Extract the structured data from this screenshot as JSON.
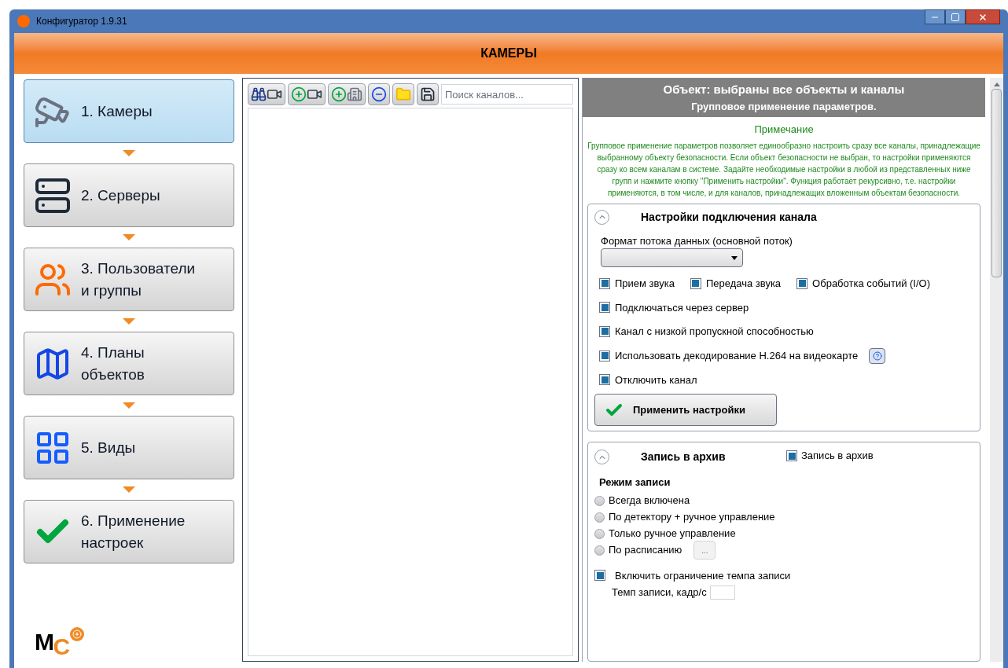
{
  "window": {
    "title": "Конфигуратор 1.9.31"
  },
  "header": {
    "title": "КАМЕРЫ"
  },
  "sidebar": {
    "items": [
      {
        "kind": "camera",
        "lines": [
          "1. Камеры"
        ],
        "selected": true
      },
      {
        "kind": "server",
        "lines": [
          "2. Серверы"
        ],
        "selected": false
      },
      {
        "kind": "users",
        "lines": [
          "3. Пользователи",
          "и группы"
        ],
        "selected": false
      },
      {
        "kind": "plans",
        "lines": [
          "4. Планы",
          "объектов"
        ],
        "selected": false
      },
      {
        "kind": "views",
        "lines": [
          "5. Виды"
        ],
        "selected": false
      },
      {
        "kind": "apply",
        "lines": [
          "6. Применение",
          "настроек"
        ],
        "selected": false
      }
    ]
  },
  "logo": {
    "letters": [
      "M",
      "C"
    ]
  },
  "toolbar": {
    "buttons": [
      {
        "kind": "find"
      },
      {
        "kind": "add-camera"
      },
      {
        "kind": "add-object"
      },
      {
        "kind": "remove"
      },
      {
        "kind": "open"
      },
      {
        "kind": "save"
      }
    ],
    "search": {
      "placeholder": "Поиск каналов..."
    }
  },
  "object_header": {
    "title": "Объект:  выбраны все объекты и каналы",
    "subtitle": "Групповое применение параметров."
  },
  "note": {
    "title": "Примечание",
    "text": "Групповое применение параметров позволяет единообразно настроить сразу все каналы, принадлежащие выбранному объекту безопасности. Если объект безопасности не выбран, то настройки применяются сразу ко всем каналам в системе. Задайте необходимые настройки в любой из представленных ниже групп и нажмите кнопку \"Применить настройки\".  Функция работает рекурсивно, т.е. настройки применяются, в том числе, и для каналов, принадлежащих вложенным объектам безопасности."
  },
  "connection": {
    "title": "Настройки подключения канала",
    "expanded": true,
    "format_label": "Формат потока данных (основной поток)",
    "checkbox_rows": [
      [
        {
          "label": "Прием звука",
          "indeterminate": true
        },
        {
          "label": "Передача звука",
          "indeterminate": true
        },
        {
          "label": "Обработка событий (I/O)",
          "indeterminate": true
        }
      ],
      [
        {
          "label": "Подключаться через сервер",
          "indeterminate": true
        }
      ],
      [
        {
          "label": "Канал с низкой пропускной способностью",
          "indeterminate": true
        }
      ],
      [
        {
          "label": "Использовать декодирование H.264 на видеокарте",
          "indeterminate": true,
          "help": true
        }
      ],
      [
        {
          "label": "Отключить канал",
          "indeterminate": true
        }
      ]
    ],
    "apply_button": "Применить настройки"
  },
  "archive": {
    "title": "Запись в архив",
    "expanded": true,
    "checkbox": {
      "label": "Запись в архив",
      "indeterminate": true
    },
    "mode_label": "Режим записи",
    "modes": [
      {
        "label": "Всегда включена",
        "selected": false
      },
      {
        "label": "По детектору + ручное управление",
        "selected": false
      },
      {
        "label": "Только ручное управление",
        "selected": false
      },
      {
        "label": "По расписанию",
        "selected": false,
        "button": "..."
      }
    ],
    "limit": {
      "label": "Включить ограничение темпа записи",
      "indeterminate": true
    },
    "rate_label": "Темп записи, кадр/с"
  }
}
